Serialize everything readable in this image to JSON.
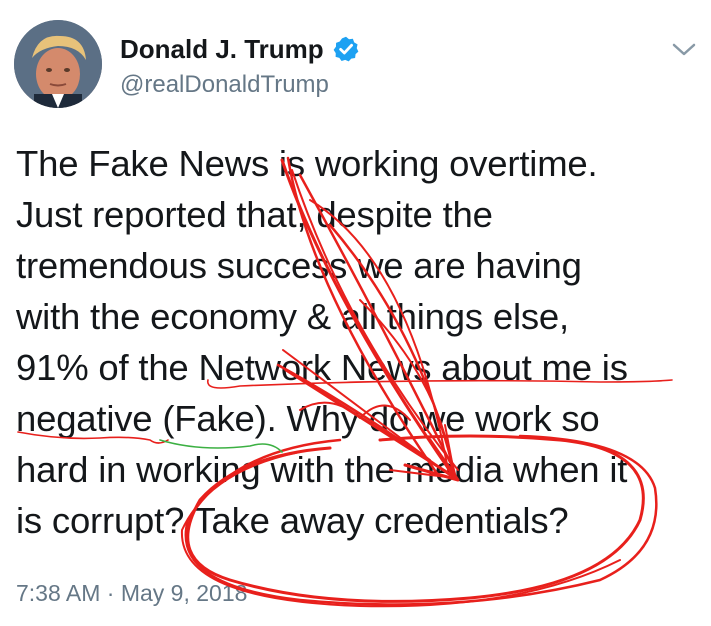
{
  "tweet": {
    "author_name": "Donald J. Trump",
    "author_handle": "@realDonaldTrump",
    "lines": [
      "The Fake News is working overtime.",
      "Just reported that, despite the",
      "tremendous success we are having",
      "with the economy & all things else,",
      "91% of the Network News about me is",
      "negative (Fake). Why do we work so",
      "hard in working with the media when it",
      "is corrupt? Take away credentials?"
    ],
    "time": "7:38 AM",
    "separator": "·",
    "date": "May 9, 2018"
  },
  "colors": {
    "verified_badge": "#1da1f2",
    "secondary_text": "#657786",
    "annotation_red": "#e8201c",
    "annotation_green": "#3cb043"
  },
  "icons": {
    "verified": "verified-badge-icon",
    "menu": "chevron-down-icon"
  }
}
